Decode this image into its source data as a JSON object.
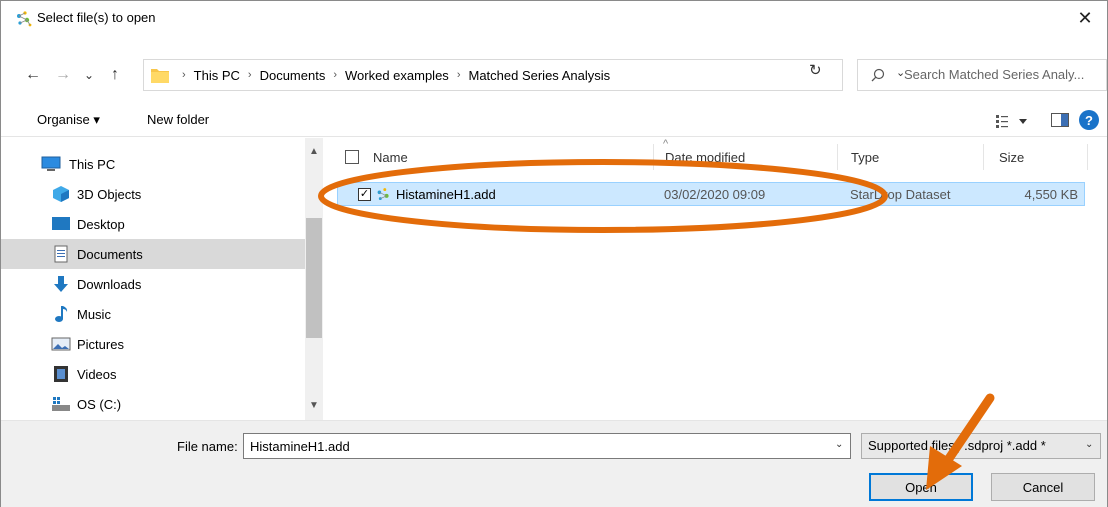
{
  "window": {
    "title": "Select file(s) to open",
    "close_glyph": "✕"
  },
  "nav": {
    "back_glyph": "←",
    "forward_glyph": "→",
    "recent_glyph": "⌄",
    "up_glyph": "↑",
    "breadcrumbs": [
      "This PC",
      "Documents",
      "Worked examples",
      "Matched Series Analysis"
    ],
    "separator": "›",
    "dropdown_glyph": "⌄",
    "refresh_glyph": "↻",
    "search_placeholder": "Search Matched Series Analy..."
  },
  "toolbar": {
    "organise_label": "Organise ▾",
    "new_folder_label": "New folder",
    "help_label": "?"
  },
  "sidebar": {
    "items": [
      {
        "label": "This PC",
        "icon": "computer-icon"
      },
      {
        "label": "3D Objects",
        "icon": "cube-icon"
      },
      {
        "label": "Desktop",
        "icon": "desktop-icon"
      },
      {
        "label": "Documents",
        "icon": "document-icon",
        "selected": true
      },
      {
        "label": "Downloads",
        "icon": "download-icon"
      },
      {
        "label": "Music",
        "icon": "music-icon"
      },
      {
        "label": "Pictures",
        "icon": "pictures-icon"
      },
      {
        "label": "Videos",
        "icon": "video-icon"
      },
      {
        "label": "OS (C:)",
        "icon": "drive-icon"
      }
    ],
    "scroll_up_glyph": "▲",
    "scroll_down_glyph": "▼"
  },
  "filelist": {
    "columns": [
      "Name",
      "Date modified",
      "Type",
      "Size"
    ],
    "sort_glyph": "^",
    "rows": [
      {
        "name": "HistamineH1.add",
        "date": "03/02/2020 09:09",
        "type": "StarDrop Dataset",
        "size": "4,550 KB",
        "checked": "✓"
      }
    ]
  },
  "bottom": {
    "file_name_label": "File name:",
    "file_name_value": "HistamineH1.add",
    "dropdown_glyph": "⌄",
    "file_type_value": "Supported files(*.sdproj *.add *",
    "open_label": "Open",
    "cancel_label": "Cancel"
  },
  "colors": {
    "accent": "#0078d7",
    "selection": "#cce8ff",
    "annotation": "#e36c0a"
  }
}
